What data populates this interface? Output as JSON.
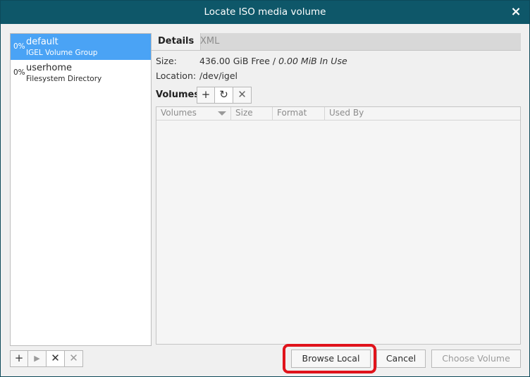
{
  "window": {
    "title": "Locate ISO media volume",
    "close_glyph": "×"
  },
  "pools": [
    {
      "percent": "0%",
      "name": "default",
      "type": "IGEL Volume Group",
      "selected": true
    },
    {
      "percent": "0%",
      "name": "userhome",
      "type": "Filesystem Directory",
      "selected": false
    }
  ],
  "pool_toolbar": {
    "add": "+",
    "start": "▶",
    "stop": "✕",
    "delete": "✕"
  },
  "tabs": [
    {
      "label": "Details",
      "active": true
    },
    {
      "label": "XML",
      "active": false
    }
  ],
  "details": {
    "size_label": "Size:",
    "size_free": "436.00 GiB Free / ",
    "size_in_use": "0.00 MiB In Use",
    "location_label": "Location:",
    "location_value": "/dev/igel"
  },
  "volumes": {
    "title": "Volumes",
    "add": "+",
    "refresh": "↻",
    "delete": "✕",
    "columns": [
      "Volumes",
      "Size",
      "Format",
      "Used By"
    ],
    "rows": []
  },
  "buttons": {
    "browse_local": "Browse Local",
    "cancel": "Cancel",
    "choose_volume": "Choose Volume"
  },
  "colors": {
    "titlebar": "#0e5769",
    "selection": "#4aa3f5",
    "highlight": "#e0131b"
  }
}
